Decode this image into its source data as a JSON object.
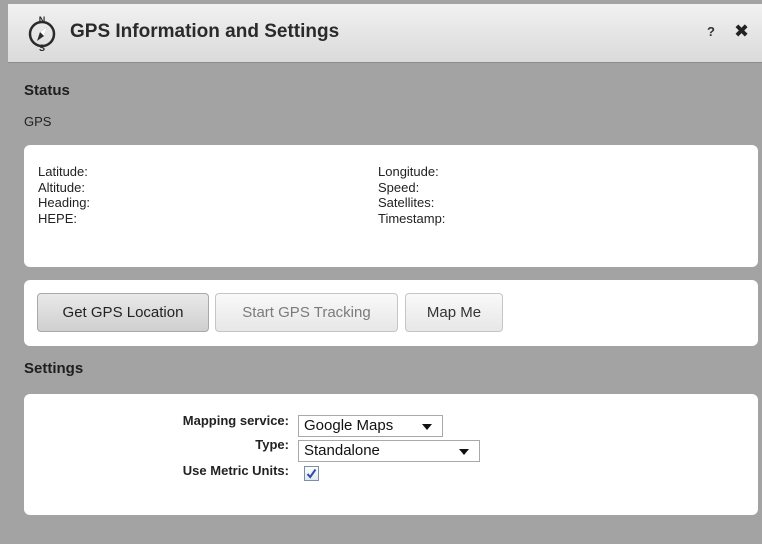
{
  "window": {
    "title": "GPS Information and Settings",
    "help_label": "?",
    "close_label": "✖"
  },
  "status": {
    "heading": "Status",
    "source": "GPS",
    "fields_left": [
      "Latitude:",
      "Altitude:",
      "Heading:",
      "HEPE:"
    ],
    "fields_right": [
      "Longitude:",
      "Speed:",
      "Satellites:",
      "Timestamp:"
    ]
  },
  "actions": {
    "get_location": "Get GPS Location",
    "start_tracking": "Start GPS Tracking",
    "map_me": "Map Me"
  },
  "settings": {
    "heading": "Settings",
    "mapping_service_label": "Mapping service:",
    "mapping_service_value": "Google Maps",
    "type_label": "Type:",
    "type_value": "Standalone",
    "metric_label": "Use Metric Units:",
    "metric_checked": true
  },
  "icons": {
    "title": "compass-icon",
    "check": "checkmark-icon"
  },
  "colors": {
    "background": "#a3a3a3",
    "panel": "#ffffff",
    "check": "#2b4fa8"
  }
}
